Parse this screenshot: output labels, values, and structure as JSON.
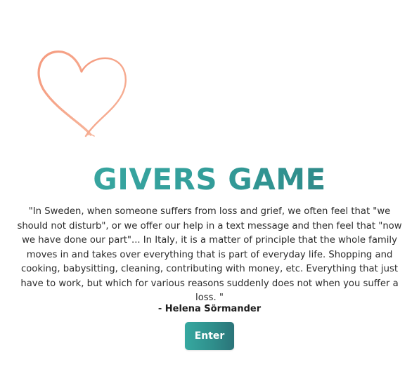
{
  "app": {
    "title": "GIVERS GAME"
  },
  "quote": {
    "text": "\"In Sweden, when someone suffers from loss and grief, we often feel that \"we should not disturb\", or we offer our help in a text message and then feel that \"now we have done our part\"... In Italy, it is a matter of principle that the whole family moves in and takes over everything that is part of everyday life. Shopping and cooking, babysitting, cleaning, contributing with money, etc. Everything that just have to work, but which for various reasons suddenly does not when you suffer a loss. \"",
    "author": "- Helena Sörmander"
  },
  "actions": {
    "enter_label": "Enter"
  },
  "icons": {
    "heart": "heart-icon"
  },
  "colors": {
    "heart_stroke": "#f4a085",
    "title_gradient_start": "#3aa9a2",
    "title_gradient_end": "#2c7c7d",
    "button_gradient_start": "#36a8a0",
    "button_gradient_end": "#2b7479",
    "button_text": "#ffffff"
  }
}
